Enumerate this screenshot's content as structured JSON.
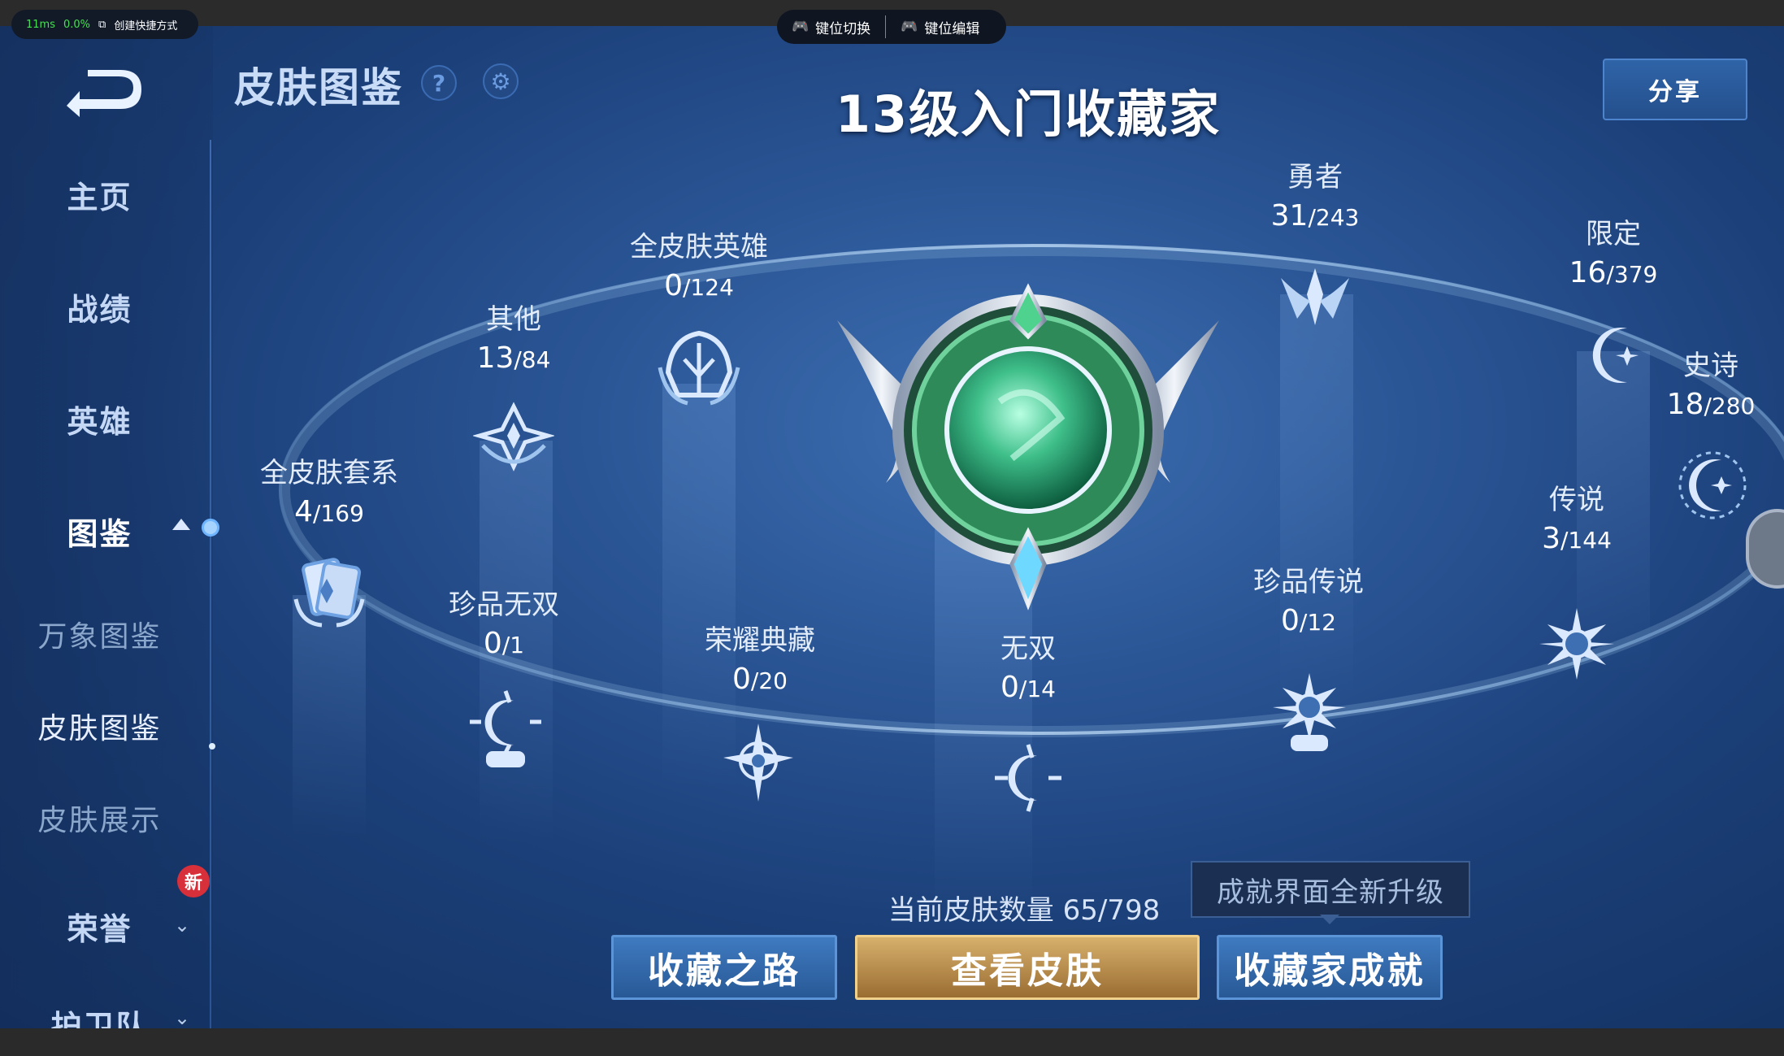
{
  "overlay": {
    "latency": "11ms",
    "loss": "0.0%",
    "shortcut_label": "创建快捷方式",
    "key_switch": "键位切换",
    "key_edit": "键位编辑"
  },
  "header": {
    "title": "皮肤图鉴",
    "share": "分享",
    "rank_title": "13级入门收藏家"
  },
  "sidebar": {
    "items": [
      {
        "label": "主页"
      },
      {
        "label": "战绩"
      },
      {
        "label": "英雄"
      },
      {
        "label": "图鉴"
      },
      {
        "label": "万象图鉴"
      },
      {
        "label": "皮肤图鉴"
      },
      {
        "label": "皮肤展示"
      },
      {
        "label": "荣誉"
      },
      {
        "label": "护卫队"
      }
    ],
    "new_badge": "新"
  },
  "nodes": [
    {
      "label": "全皮肤套系",
      "have": "4",
      "total": "/169"
    },
    {
      "label": "其他",
      "have": "13",
      "total": "/84"
    },
    {
      "label": "全皮肤英雄",
      "have": "0",
      "total": "/124"
    },
    {
      "label": "勇者",
      "have": "31",
      "total": "/243"
    },
    {
      "label": "限定",
      "have": "16",
      "total": "/379"
    },
    {
      "label": "史诗",
      "have": "18",
      "total": "/280"
    },
    {
      "label": "传说",
      "have": "3",
      "total": "/144"
    },
    {
      "label": "珍品传说",
      "have": "0",
      "total": "/12"
    },
    {
      "label": "无双",
      "have": "0",
      "total": "/14"
    },
    {
      "label": "荣耀典藏",
      "have": "0",
      "total": "/20"
    },
    {
      "label": "珍品无双",
      "have": "0",
      "total": "/1"
    }
  ],
  "footer": {
    "current_count": "当前皮肤数量 65/798",
    "tip": "成就界面全新升级",
    "btn_road": "收藏之路",
    "btn_view": "查看皮肤",
    "btn_achieve": "收藏家成就"
  },
  "colors": {
    "accent_gold": "#d7b06c",
    "accent_blue": "#3f7ac0",
    "emblem_green": "#3fbf8a"
  }
}
